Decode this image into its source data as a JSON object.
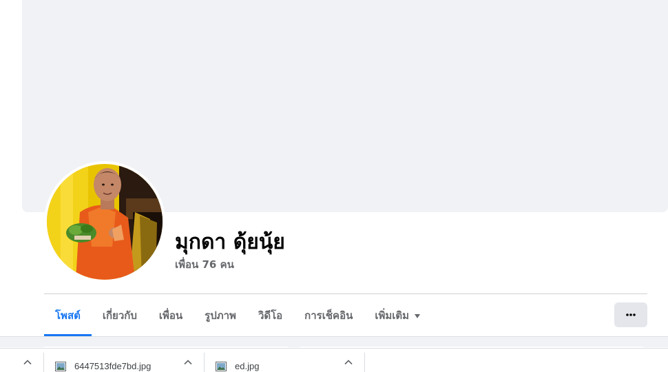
{
  "profile": {
    "name": "มุกดา ดุ้ยนุ้ย",
    "friends_text": "เพื่อน 76 คน"
  },
  "tabs": [
    {
      "label": "โพสต์",
      "active": true
    },
    {
      "label": "เกี่ยวกับ",
      "active": false
    },
    {
      "label": "เพื่อน",
      "active": false
    },
    {
      "label": "รูปภาพ",
      "active": false
    },
    {
      "label": "วิดีโอ",
      "active": false
    },
    {
      "label": "การเช็คอิน",
      "active": false
    },
    {
      "label": "เพิ่มเติม",
      "active": false,
      "icon": "caret-down-icon"
    }
  ],
  "more_button": {
    "icon": "ellipsis-icon"
  },
  "downloads": [
    {
      "filename": "6447513fde7bd.jpg",
      "icon": "image-file-icon"
    },
    {
      "filename": "ed.jpg",
      "icon": "image-file-icon"
    }
  ],
  "colors": {
    "accent": "#1877f2",
    "secondary_text": "#65676b",
    "cover": "#f0f2f5"
  }
}
